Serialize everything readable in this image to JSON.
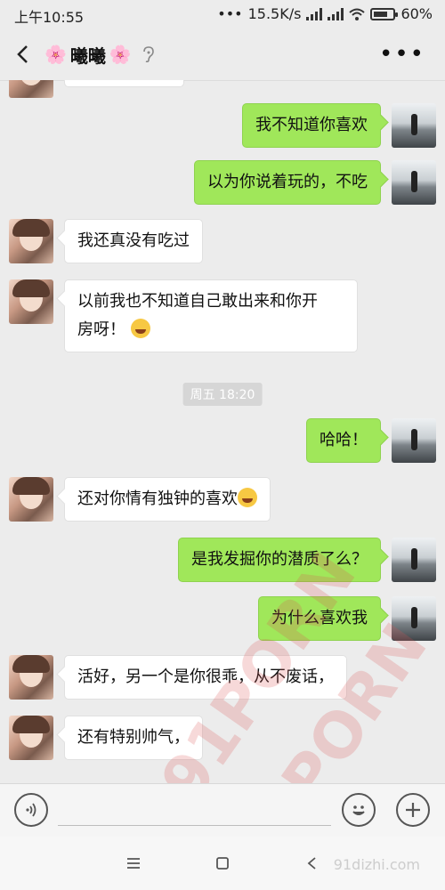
{
  "status": {
    "time": "上午10:55",
    "signal_dots": "•••",
    "net_speed": "15.5K/s",
    "battery": "60%"
  },
  "header": {
    "flower_left": "🌸",
    "contact_name": "曦曦",
    "flower_right": "🌸"
  },
  "messages": [
    {
      "side": "out",
      "text": "我不知道你喜欢"
    },
    {
      "side": "out",
      "text": "以为你说着玩的，不吃"
    },
    {
      "side": "in",
      "text": "我还真没有吃过"
    },
    {
      "side": "in",
      "text_line1": "以前我也不知道自己敢出来和你开",
      "text_line2": "房呀！"
    },
    {
      "timestamp": "周五 18:20"
    },
    {
      "side": "out",
      "text": "哈哈！"
    },
    {
      "side": "in",
      "text": "还对你情有独钟的喜欢"
    },
    {
      "side": "out",
      "text": "是我发掘你的潜质了么？"
    },
    {
      "side": "out",
      "text": "为什么喜欢我"
    },
    {
      "side": "in",
      "text": "活好，另一个是你很乖，从不废话，"
    },
    {
      "side": "in",
      "text": "还有特别帅气，"
    }
  ],
  "watermark": {
    "text_a": "91PORN",
    "text_b": "91PORN",
    "site": "91dizhi.com"
  },
  "icons": [
    "back-arrow-icon",
    "ear-icon",
    "more-icon",
    "voice-icon",
    "emoji-icon",
    "plus-icon",
    "menu-icon",
    "home-icon",
    "nav-back-icon"
  ]
}
